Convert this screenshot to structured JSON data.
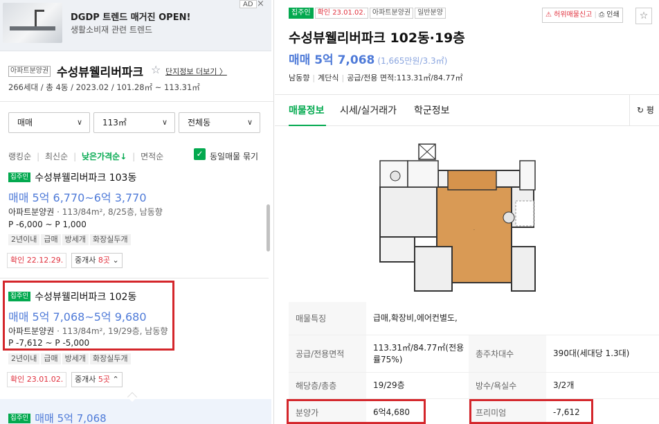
{
  "ad": {
    "title": "DGDP 트렌드 매거진 OPEN!",
    "subtitle": "생활소비재 관련 트렌드",
    "tag": "AD",
    "close": "×"
  },
  "complex": {
    "type_tag": "아파트분양권",
    "name": "수성뷰웰리버파크",
    "star": "☆",
    "more": "단지정보 더보기 〉",
    "info": "266세대 / 총 4동 / 2023.02 / 101.28㎡ ~ 113.31㎡"
  },
  "filters": {
    "trade": "매매",
    "area": "113㎡",
    "dong": "전체동"
  },
  "sorts": {
    "items": [
      "랭킹순",
      "최신순",
      "낮은가격순↓",
      "면적순"
    ],
    "active_index": 2,
    "group_label": "동일매물 묶기",
    "group_checked": true
  },
  "listings": [
    {
      "badge": "집주인",
      "name": "수성뷰웰리버파크 103동",
      "price": "매매 5억 6,770~6억 3,770",
      "type": "아파트분양권",
      "meta": " · 113/84m², 8/25층, 남동향",
      "premium": "P -6,000 ~ P 1,000",
      "tags": [
        "2년이내",
        "급매",
        "방세개",
        "화장실두개"
      ],
      "confirm": "확인 22.12.29.",
      "agent_prefix": "중개사 ",
      "agent_count": "8곳",
      "agent_chev": "⌄"
    },
    {
      "badge": "집주인",
      "name": "수성뷰웰리버파크 102동",
      "price": "매매 5억 7,068~5억 9,680",
      "type": "아파트분양권",
      "meta": " · 113/84m², 19/29층, 남동향",
      "premium": "P -7,612 ~ P -5,000",
      "tags": [
        "2년이내",
        "급매",
        "방세개",
        "화장실두개"
      ],
      "confirm": "확인 23.01.02.",
      "agent_prefix": "중개사 ",
      "agent_count": "5곳",
      "agent_chev": "⌃"
    }
  ],
  "bottom_item": {
    "badge": "집주인",
    "price": "매매 5억 7,068"
  },
  "detail": {
    "tags": [
      "집주인",
      "확인 23.01.02.",
      "아파트분양권",
      "일반분양"
    ],
    "report_label": "허위매물신고",
    "print_label": "인쇄",
    "title": "수성뷰웰리버파크 102동·19층",
    "price": "매매 5억 7,068",
    "price_unit": "(1,665만원/3.3㎡)",
    "spec": [
      "남동향",
      "계단식",
      "공급/전용 면적:113.31㎡/84.77㎡"
    ],
    "tabs": [
      "매물정보",
      "시세/실거래가",
      "학군정보"
    ],
    "tab_right": "↻ 평",
    "table": [
      {
        "label": "매물특징",
        "value": "급매,확장비,에어컨별도,"
      },
      {
        "label": "공급/전용면적",
        "value": "113.31㎡/84.77㎡(전용률75%)",
        "label2": "총주차대수",
        "value2": "390대(세대당 1.3대)"
      },
      {
        "label": "해당층/총층",
        "value": "19/29층",
        "label2": "방수/욕실수",
        "value2": "3/2개"
      },
      {
        "label": "분양가",
        "value": "6억4,680",
        "label2": "프리미엄",
        "value2": "-7,612"
      }
    ]
  },
  "colors": {
    "green": "#03a94f",
    "blue": "#4e7ad8",
    "red": "#d4262b"
  }
}
